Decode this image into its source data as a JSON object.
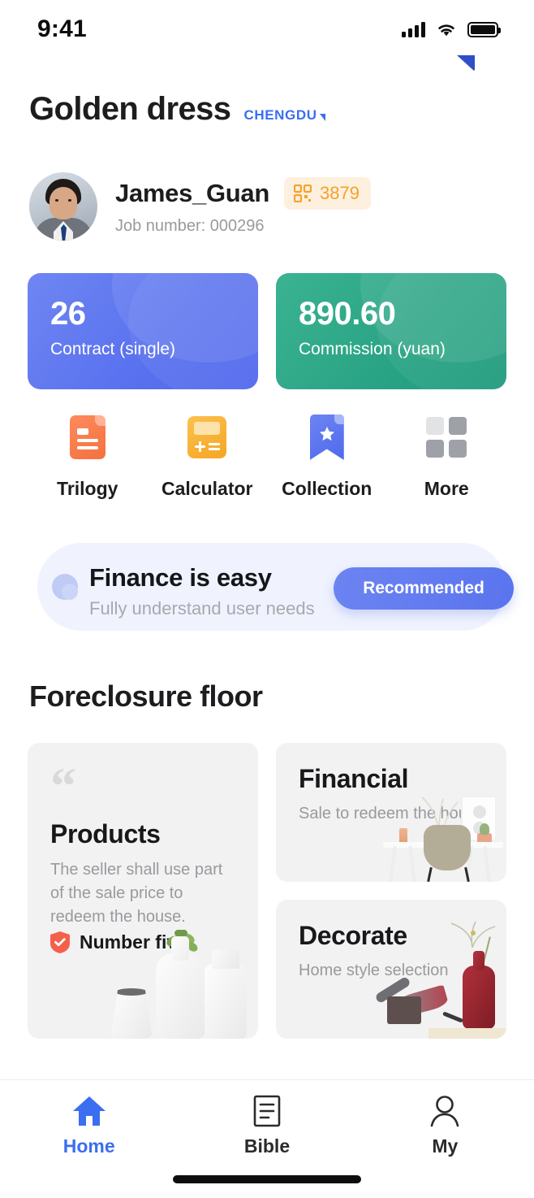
{
  "status_bar": {
    "time": "9:41",
    "signal_icon": "signal-bars-icon",
    "wifi_icon": "wifi-icon",
    "battery_icon": "battery-full-icon"
  },
  "header": {
    "title": "Golden dress",
    "city": "CHENGDU",
    "city_caret_icon": "caret-down-icon",
    "city_color": "#3b6ef0"
  },
  "profile": {
    "avatar_alt": "user-avatar",
    "name": "James_Guan",
    "job_number": "Job number: 000296",
    "badge": {
      "icon": "qr-code-icon",
      "count": "3879",
      "text_color": "#f5a22a",
      "background": "#fdf0df"
    }
  },
  "stats": [
    {
      "value": "26",
      "label": "Contract (single)",
      "color": "#5a72ef"
    },
    {
      "value": "890.60",
      "label": "Commission (yuan)",
      "color": "#28a383"
    }
  ],
  "quick_actions": [
    {
      "label": "Trilogy",
      "icon": "document-icon",
      "color": "#f5703f"
    },
    {
      "label": "Calculator",
      "icon": "calculator-icon",
      "color": "#f5a623"
    },
    {
      "label": "Collection",
      "icon": "bookmark-star-icon",
      "color": "#4f6aec"
    },
    {
      "label": "More",
      "icon": "grid-icon",
      "color": "#9ea2a8"
    }
  ],
  "banner": {
    "title": "Finance is easy",
    "subtitle": "Fully understand user needs",
    "button_label": "Recommended",
    "background": "#f0f3fe",
    "button_color": "#5a74ee"
  },
  "section": {
    "title": "Foreclosure floor"
  },
  "cards": {
    "products": {
      "quote_icon": "quote-mark-icon",
      "title": "Products",
      "description": "The seller shall use part of the sale price to redeem the house.",
      "badge_icon": "shield-check-icon",
      "badge_label": "Number five",
      "badge_color": "#f4604a",
      "image_alt": "white-ceramic-vases-photo"
    },
    "financial": {
      "title": "Financial",
      "description": "Sale to redeem the house.",
      "image_alt": "desk-and-chair-photo"
    },
    "decorate": {
      "title": "Decorate",
      "description": "Home style selection",
      "image_alt": "bird-sculpture-and-red-vase-photo"
    }
  },
  "tabbar": {
    "items": [
      {
        "label": "Home",
        "icon": "home-icon",
        "active": true
      },
      {
        "label": "Bible",
        "icon": "document-lines-icon",
        "active": false
      },
      {
        "label": "My",
        "icon": "person-icon",
        "active": false
      }
    ],
    "active_color": "#3b6ef0"
  }
}
